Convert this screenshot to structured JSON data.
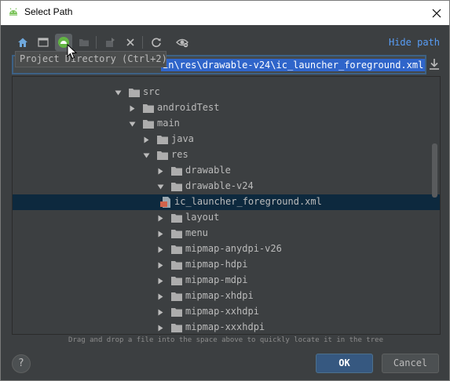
{
  "window": {
    "title": "Select Path",
    "app_icon": "android-icon",
    "close_icon": "close-icon"
  },
  "toolbar": {
    "buttons": [
      {
        "name": "home-icon",
        "active": false
      },
      {
        "name": "desktop-icon",
        "active": false
      },
      {
        "name": "project-directory-icon",
        "active": true
      },
      {
        "name": "new-folder-icon",
        "active": false
      },
      {
        "name": "move-icon",
        "active": false
      },
      {
        "name": "delete-icon",
        "active": false
      },
      {
        "name": "refresh-icon",
        "active": false
      },
      {
        "name": "show-hidden-icon",
        "active": false
      }
    ],
    "hide_path_label": "Hide path"
  },
  "tooltip": {
    "text": "Project Directory (Ctrl+2)"
  },
  "path_field": {
    "value": "in\\res\\drawable-v24\\ic_launcher_foreground.xml"
  },
  "tree": {
    "items": [
      {
        "label": "src",
        "expanded": true,
        "type": "folder",
        "depth": 0
      },
      {
        "label": "androidTest",
        "expanded": false,
        "type": "folder",
        "depth": 1
      },
      {
        "label": "main",
        "expanded": true,
        "type": "folder",
        "depth": 1
      },
      {
        "label": "java",
        "expanded": false,
        "type": "folder",
        "depth": 2
      },
      {
        "label": "res",
        "expanded": true,
        "type": "folder",
        "depth": 2
      },
      {
        "label": "drawable",
        "expanded": false,
        "type": "folder",
        "depth": 3
      },
      {
        "label": "drawable-v24",
        "expanded": true,
        "type": "folder",
        "depth": 3
      },
      {
        "label": "ic_launcher_foreground.xml",
        "type": "xml-file",
        "depth": 4,
        "selected": true
      },
      {
        "label": "layout",
        "expanded": false,
        "type": "folder",
        "depth": 3
      },
      {
        "label": "menu",
        "expanded": false,
        "type": "folder",
        "depth": 3
      },
      {
        "label": "mipmap-anydpi-v26",
        "expanded": false,
        "type": "folder",
        "depth": 3
      },
      {
        "label": "mipmap-hdpi",
        "expanded": false,
        "type": "folder",
        "depth": 3
      },
      {
        "label": "mipmap-mdpi",
        "expanded": false,
        "type": "folder",
        "depth": 3
      },
      {
        "label": "mipmap-xhdpi",
        "expanded": false,
        "type": "folder",
        "depth": 3
      },
      {
        "label": "mipmap-xxhdpi",
        "expanded": false,
        "type": "folder",
        "depth": 3
      },
      {
        "label": "mipmap-xxxhdpi",
        "expanded": false,
        "type": "folder",
        "depth": 3
      }
    ]
  },
  "hint": "Drag and drop a file into the space above to quickly locate it in the tree",
  "buttons": {
    "help": "?",
    "ok": "OK",
    "cancel": "Cancel"
  },
  "colors": {
    "background": "#3c3f41",
    "text": "#bbbbbb",
    "accent_link": "#589df6",
    "selection": "#0d293e",
    "path_highlight": "#2f65ca",
    "ok_button": "#365880",
    "folder": "#adadad",
    "xml_icon": "#d1634b"
  }
}
